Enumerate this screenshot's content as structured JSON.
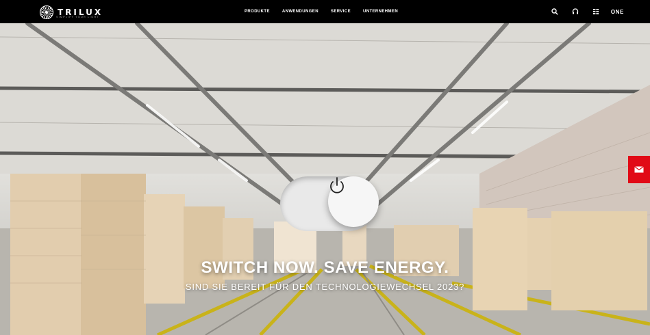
{
  "header": {
    "logo_text": "TRILUX",
    "logo_tagline": "SIMPLIFY YOUR LIGHT",
    "nav": [
      "PRODUKTE",
      "ANWENDUNGEN",
      "SERVICE",
      "UNTERNEHMEN"
    ],
    "tools": {
      "search_icon": "search-icon",
      "headset_icon": "headset-icon",
      "grid_icon": "grid-icon",
      "one_label": "ONE"
    }
  },
  "hero": {
    "headline": "SWITCH NOW. SAVE ENERGY.",
    "subheadline": "SIND SIE BEREIT FÜR DEN TECHNOLOGIEWECHSEL 2023?",
    "toggle_state": "on",
    "contact_icon": "mail-icon"
  },
  "colors": {
    "topbar": "#000000",
    "accent_red": "#e10a16",
    "text_white": "#ffffff"
  }
}
